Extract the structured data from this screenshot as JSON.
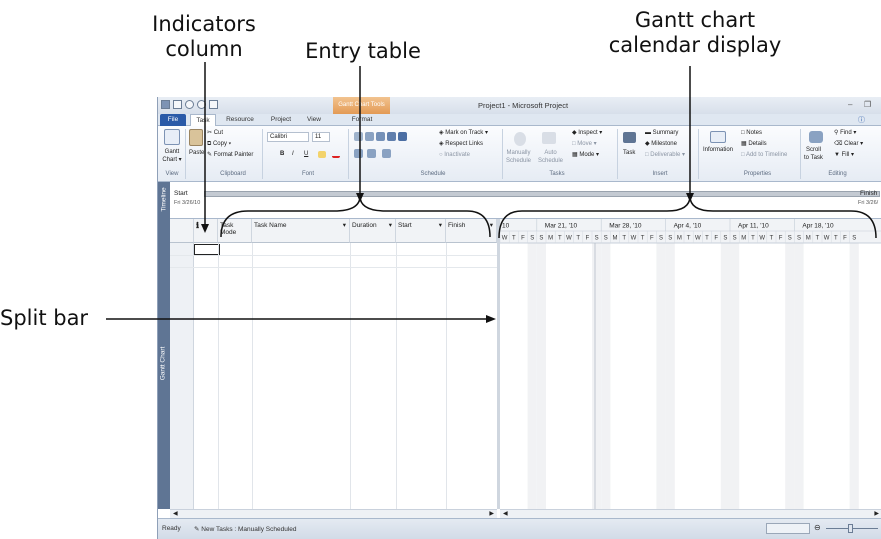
{
  "callouts": {
    "indicators": [
      "Indicators",
      "column"
    ],
    "entry_table": "Entry table",
    "gantt_calendar": [
      "Gantt chart",
      "calendar display"
    ],
    "split_bar": "Split bar"
  },
  "window": {
    "title": "Project1 - Microsoft Project",
    "context_tab": "Gantt Chart Tools"
  },
  "tabs": [
    "File",
    "Task",
    "Resource",
    "Project",
    "View",
    "Format"
  ],
  "selected_tab": "Task",
  "ribbon": {
    "view_group": {
      "gantt_chart": [
        "Gantt",
        "Chart ▾"
      ],
      "label": "View"
    },
    "clipboard": {
      "paste": "Paste",
      "cut": "Cut",
      "copy": "Copy ▾",
      "format_painter": "Format Painter",
      "label": "Clipboard"
    },
    "font": {
      "family": "Calibri",
      "size": "11",
      "bold": "B",
      "italic": "I",
      "underline": "U",
      "label": "Font"
    },
    "schedule": {
      "mark_on_track": "Mark on Track ▾",
      "respect_links": "Respect Links",
      "inactivate": "Inactivate",
      "percent": [
        "0x",
        "25x",
        "50x",
        "75x",
        "100x"
      ],
      "label": "Schedule"
    },
    "tasks": {
      "manually_schedule": [
        "Manually",
        "Schedule"
      ],
      "auto_schedule": [
        "Auto",
        "Schedule"
      ],
      "inspect": "Inspect ▾",
      "move": "Move ▾",
      "mode": "Mode ▾",
      "label": "Tasks"
    },
    "insert": {
      "task": "Task",
      "summary": "Summary",
      "milestone": "Milestone",
      "deliverable": "Deliverable ▾",
      "label": "Insert"
    },
    "properties": {
      "information": "Information",
      "notes": "Notes",
      "details": "Details",
      "add_to_timeline": "Add to Timeline",
      "label": "Properties"
    },
    "editing": {
      "scroll_to_task": [
        "Scroll",
        "to Task"
      ],
      "find": "Find ▾",
      "clear": "Clear ▾",
      "fill": "Fill ▾",
      "label": "Editing"
    }
  },
  "timeline": {
    "side_label": "Timeline",
    "start_label": "Start",
    "start_date": "Fri 3/26/10",
    "finish_label": "Finish",
    "finish_date": "Fri 3/26/"
  },
  "table": {
    "side_label": "Gantt Chart",
    "columns": [
      {
        "key": "indicators",
        "label": "ℹ"
      },
      {
        "key": "task_mode",
        "label": "Task Mode"
      },
      {
        "key": "task_name",
        "label": "Task Name"
      },
      {
        "key": "duration",
        "label": "Duration"
      },
      {
        "key": "start",
        "label": "Start"
      },
      {
        "key": "finish",
        "label": "Finish"
      }
    ]
  },
  "gantt": {
    "first_week": "10",
    "weeks": [
      "Mar 21, '10",
      "Mar 28, '10",
      "Apr 4, '10",
      "Apr 11, '10",
      "Apr 18, '10"
    ],
    "days": [
      "S",
      "M",
      "T",
      "W",
      "T",
      "F",
      "S"
    ],
    "lead_days": [
      "W",
      "T",
      "F",
      "S"
    ]
  },
  "status": {
    "ready": "Ready",
    "new_tasks": "New Tasks : Manually Scheduled"
  }
}
